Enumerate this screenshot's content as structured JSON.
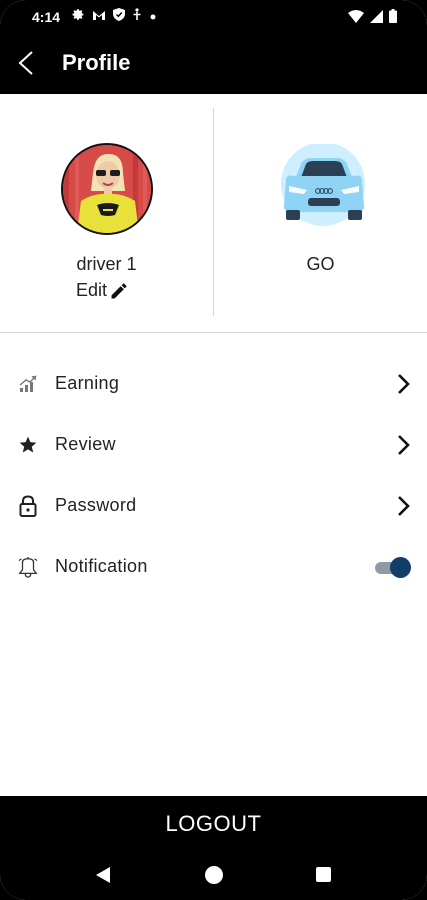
{
  "status_bar": {
    "time": "4:14",
    "left_icons": [
      "gear-icon",
      "gmail-icon",
      "shield-icon",
      "accessibility-icon",
      "dot-icon"
    ],
    "right_icons": [
      "wifi-icon",
      "signal-icon",
      "battery-icon"
    ]
  },
  "header": {
    "title": "Profile"
  },
  "profile": {
    "driver_name": "driver 1",
    "edit_label": "Edit",
    "vehicle_label": "GO"
  },
  "menu": {
    "items": [
      {
        "label": "Earning",
        "icon": "chart-icon"
      },
      {
        "label": "Review",
        "icon": "star-icon"
      },
      {
        "label": "Password",
        "icon": "lock-icon"
      },
      {
        "label": "Notification",
        "icon": "bell-icon",
        "toggle_on": true
      }
    ]
  },
  "footer": {
    "logout_label": "LOGOUT"
  },
  "colors": {
    "toggle_knob": "#123d66",
    "toggle_track": "#8e9aa6",
    "car_body": "#8fd4f5",
    "car_circle": "#cdefff"
  }
}
